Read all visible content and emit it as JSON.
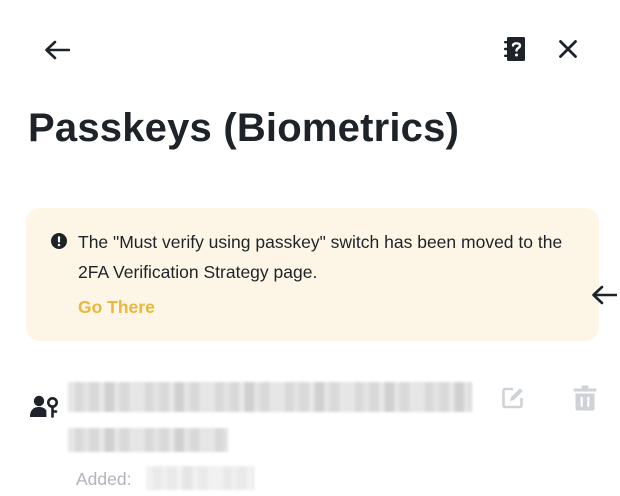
{
  "header": {
    "back_icon": "arrow-left-icon",
    "help_icon": "help-book-icon",
    "close_icon": "close-icon"
  },
  "page_title": "Passkeys (Biometrics)",
  "notice": {
    "icon": "exclamation-circle-icon",
    "message": "The \"Must verify using passkey\" switch has been moved to the 2FA Verification Strategy page.",
    "link_label": "Go There",
    "background_color": "#fdf6e6",
    "link_color": "#e9b73a"
  },
  "side_arrow_icon": "arrow-left-icon",
  "passkey": {
    "icon": "user-key-icon",
    "added_label": "Added:",
    "edit_icon": "edit-icon",
    "delete_icon": "trash-icon"
  },
  "colors": {
    "text_primary": "#1e2329",
    "text_muted": "#b0b4ba",
    "icon_disabled": "#cfd2d6"
  }
}
